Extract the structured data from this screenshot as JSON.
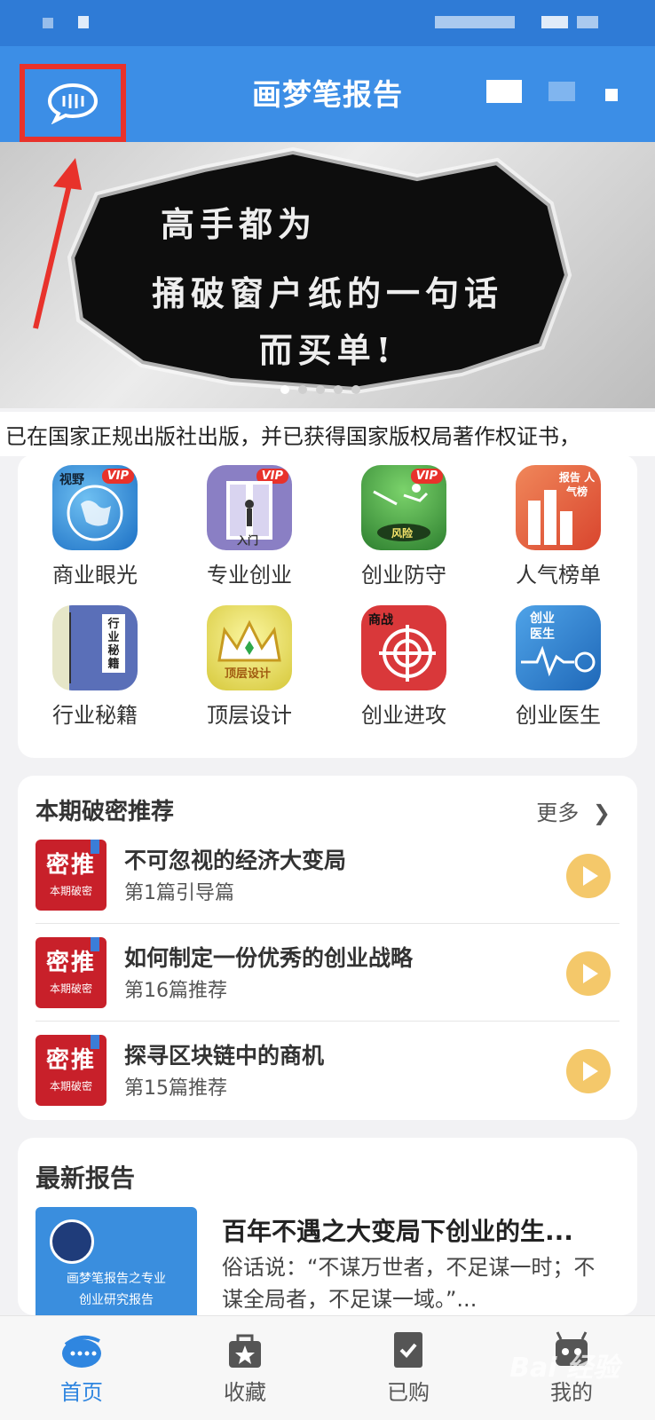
{
  "app": {
    "title": "画梦笔报告"
  },
  "banner": {
    "lines": [
      "高手都为",
      "捅破窗户纸的一句话",
      "而买单!"
    ]
  },
  "marquee": {
    "text": "已在国家正规出版社出版，并已获得国家版权局著作权证书，"
  },
  "grid": [
    {
      "label": "商业眼光",
      "icon": "globe-icon",
      "color": "#2c8fd8",
      "badge": "VIP",
      "tag": "视野"
    },
    {
      "label": "专业创业",
      "icon": "door-icon",
      "color": "#8a7fc4",
      "badge": "VIP",
      "tag": "入门"
    },
    {
      "label": "创业防守",
      "icon": "jump-icon",
      "color": "#3d9b3f",
      "badge": "VIP",
      "tag": "风险"
    },
    {
      "label": "人气榜单",
      "icon": "rank-icon",
      "color": "#ea6c44",
      "badge": "",
      "tag": "报告 人气榜"
    },
    {
      "label": "行业秘籍",
      "icon": "book-icon",
      "color": "#5a6fb8",
      "badge": "",
      "tag": "行业秘籍"
    },
    {
      "label": "顶层设计",
      "icon": "crown-icon",
      "color": "#e7e05a",
      "badge": "",
      "tag": "顶层设计"
    },
    {
      "label": "创业进攻",
      "icon": "target-icon",
      "color": "#d9383a",
      "badge": "",
      "tag": "商战"
    },
    {
      "label": "创业医生",
      "icon": "stethoscope-icon",
      "color": "#2a7fd1",
      "badge": "",
      "tag": "创业 医生"
    }
  ],
  "recommend": {
    "title": "本期破密推荐",
    "more": "更多",
    "thumb_big": "密推",
    "thumb_small": "本期破密",
    "items": [
      {
        "title": "不可忽视的经济大变局",
        "sub": "第1篇引导篇"
      },
      {
        "title": "如何制定一份优秀的创业战略",
        "sub": "第16篇推荐"
      },
      {
        "title": "探寻区块链中的商机",
        "sub": "第15篇推荐"
      }
    ]
  },
  "latest": {
    "title": "最新报告",
    "image_cap1": "画梦笔报告之专业",
    "image_cap2": "创业研究报告",
    "headline": "百年不遇之大变局下创业的生...",
    "desc": "俗话说：“不谋万世者，不足谋一时；不谋全局者，不足谋一域。”..."
  },
  "tabs": [
    {
      "label": "首页",
      "icon": "home-icon",
      "active": true
    },
    {
      "label": "收藏",
      "icon": "bookmark-bag-icon",
      "active": false
    },
    {
      "label": "已购",
      "icon": "purchased-icon",
      "active": false
    },
    {
      "label": "我的",
      "icon": "profile-icon",
      "active": false
    }
  ],
  "watermark": "Bai 经验",
  "colors": {
    "primary": "#3c8ee6",
    "highlight": "#e8322b",
    "accent_play": "#f4c86a",
    "active_tab": "#2f86e0"
  }
}
